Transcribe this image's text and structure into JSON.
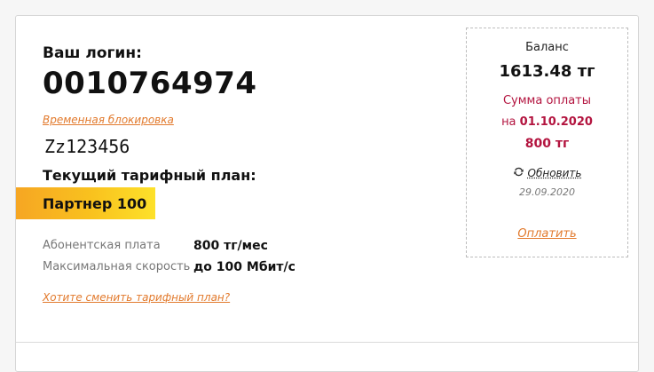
{
  "account": {
    "login_label": "Ваш логин:",
    "login_value": "0010764974",
    "temp_block_link": "Временная блокировка",
    "password": "Zz123456"
  },
  "tariff": {
    "label": "Текущий тарифный план:",
    "name": "Партнер 100",
    "details": [
      {
        "key": "Абонентская плата",
        "value": "800 тг/мес"
      },
      {
        "key": "Максимальная скорость",
        "value": "до 100 Мбит/с"
      }
    ],
    "change_link": "Хотите сменить тарифный план?"
  },
  "balance": {
    "title": "Баланс",
    "amount": "1613.48 тг",
    "payment_label": "Сумма оплаты",
    "payment_date_prefix": "на",
    "payment_date": "01.10.2020",
    "payment_amount": "800 тг",
    "refresh_label": "Обновить",
    "refresh_date": "29.09.2020",
    "pay_link": "Оплатить"
  },
  "colors": {
    "link": "#e27a2d",
    "accent_red": "#b3143f",
    "badge_gradient_start": "#f6a623",
    "badge_gradient_end": "#fde12a"
  },
  "icons": {
    "refresh": "refresh-icon"
  }
}
